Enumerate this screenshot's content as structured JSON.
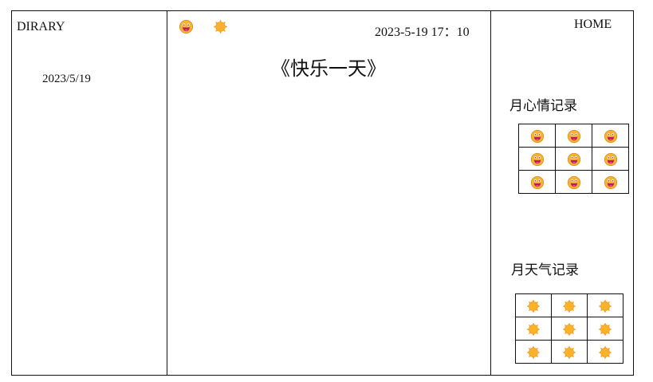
{
  "sidebar": {
    "brand": "DIRARY",
    "date": "2023/5/19"
  },
  "header": {
    "datetime": "2023-5-19 17：10",
    "home_label": "HOME"
  },
  "entry": {
    "title": "《快乐一天》",
    "mood_icon": "grinning-face-icon",
    "weather_icon": "sun-icon"
  },
  "records": {
    "mood_title": "月心情记录",
    "weather_title": "月天气记录",
    "mood_grid": [
      [
        "grinning-face-icon",
        "grinning-face-icon",
        "grinning-face-icon"
      ],
      [
        "grinning-face-icon",
        "grinning-face-icon",
        "grinning-face-icon"
      ],
      [
        "grinning-face-icon",
        "grinning-face-icon",
        "grinning-face-icon"
      ]
    ],
    "weather_grid": [
      [
        "sun-icon",
        "sun-icon",
        "sun-icon"
      ],
      [
        "sun-icon",
        "sun-icon",
        "sun-icon"
      ],
      [
        "sun-icon",
        "sun-icon",
        "sun-icon"
      ]
    ]
  },
  "colors": {
    "border": "#111111",
    "face": "#f8b234",
    "face_outline": "#d8891a",
    "mouth": "#c2185b",
    "tongue": "#f06292",
    "sun": "#f9b22a",
    "sun_ray": "#f49a1e"
  }
}
